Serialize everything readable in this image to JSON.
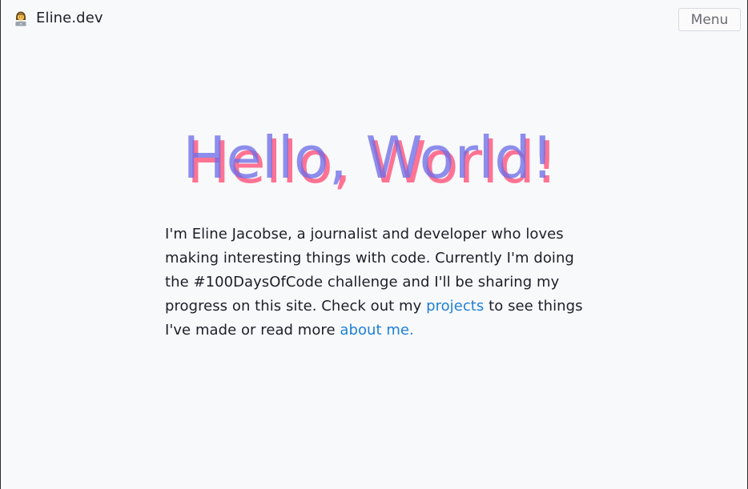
{
  "header": {
    "brand_label": "Eline.dev",
    "brand_icon": "woman-technologist-icon",
    "menu_label": "Menu"
  },
  "hero": {
    "title": "Hello, World!"
  },
  "intro": {
    "part1": "I'm Eline Jacobse, a journalist and developer who loves making interesting things with code. Currently I'm doing the #100DaysOfCode challenge and I'll be sharing my progress on this site. Check out my ",
    "projects_link": "projects",
    "part2": " to see things I've made or read more ",
    "about_link": "about me."
  },
  "colors": {
    "background": "#f8f9fb",
    "text": "#1e1e28",
    "link": "#1e7fd6",
    "title_pink": "#ff5c80",
    "title_blue": "#6e6ee8"
  }
}
